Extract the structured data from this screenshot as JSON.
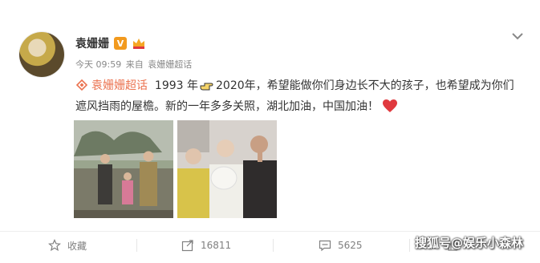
{
  "post": {
    "author": "袁姗姗",
    "vip_label": "V",
    "time": "今天 09:59",
    "from_prefix": "来自",
    "source": "袁姗姗超话",
    "topic": "袁姗姗超话",
    "text_year": "1993 年",
    "text_part2": "2020年，希望能做你们身边长不大的孩子，也希望成为你们遮风挡雨的屋檐。新的一年多多关照，湖北加油，中国加油！"
  },
  "actions": {
    "favorite_label": "收藏",
    "share_count": "16811",
    "comment_count": "5625"
  },
  "watermark": "搜狐号@娱乐小森林",
  "colors": {
    "topic": "#eb7350",
    "vip": "#f29a1e",
    "heart": "#e0393e"
  }
}
